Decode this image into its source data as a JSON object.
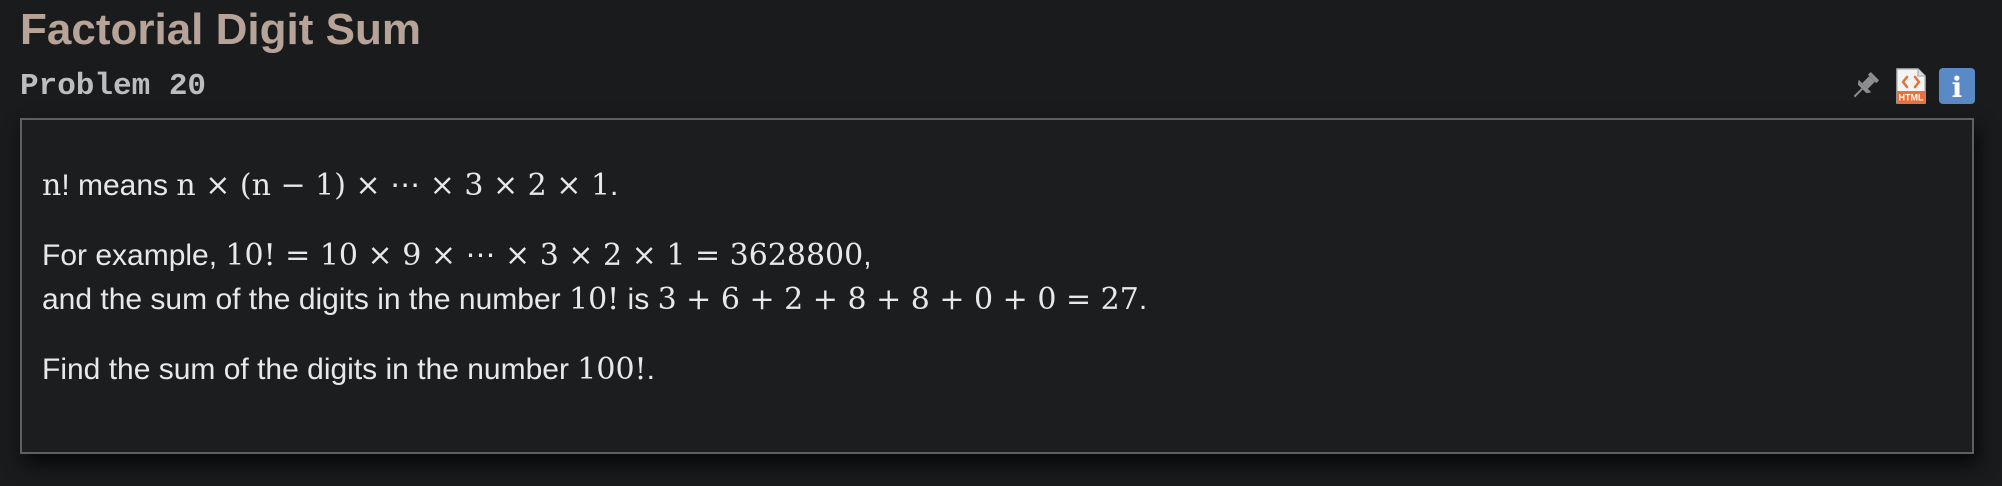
{
  "header": {
    "title": "Factorial Digit Sum",
    "subtitle": "Problem 20"
  },
  "toolbar": {
    "icons": [
      "pin-icon",
      "html-icon",
      "info-icon"
    ],
    "html_icon_label": "HTML",
    "info_icon_label": "i",
    "colors": {
      "pin": "#8e8e8e",
      "html": "#e8703a",
      "info": "#5a8ac6"
    }
  },
  "problem": {
    "line1": {
      "var_n": "n",
      "text_means": "! means ",
      "expr": "n × (n − 1) × ⋯ × 3 × 2 × 1",
      "end": "."
    },
    "line2": {
      "text": "For example, ",
      "expr": "10! = 10 × 9 × ⋯ × 3 × 2 × 1 = 3628800",
      "end": ","
    },
    "line3": {
      "text": "and the sum of the digits in the number ",
      "expr1": "10!",
      "text2": " is ",
      "expr2": "3 + 6 + 2 + 8 + 8 + 0 + 0 = 27",
      "end": "."
    },
    "line4": {
      "text": "Find the sum of the digits in the number ",
      "expr": "100!",
      "end": "."
    }
  },
  "colors": {
    "background": "#1a1b1d",
    "title": "#b7a397",
    "subtitle": "#bdbdbd",
    "panel_border": "#5e6063",
    "text": "#e8e8e8"
  }
}
